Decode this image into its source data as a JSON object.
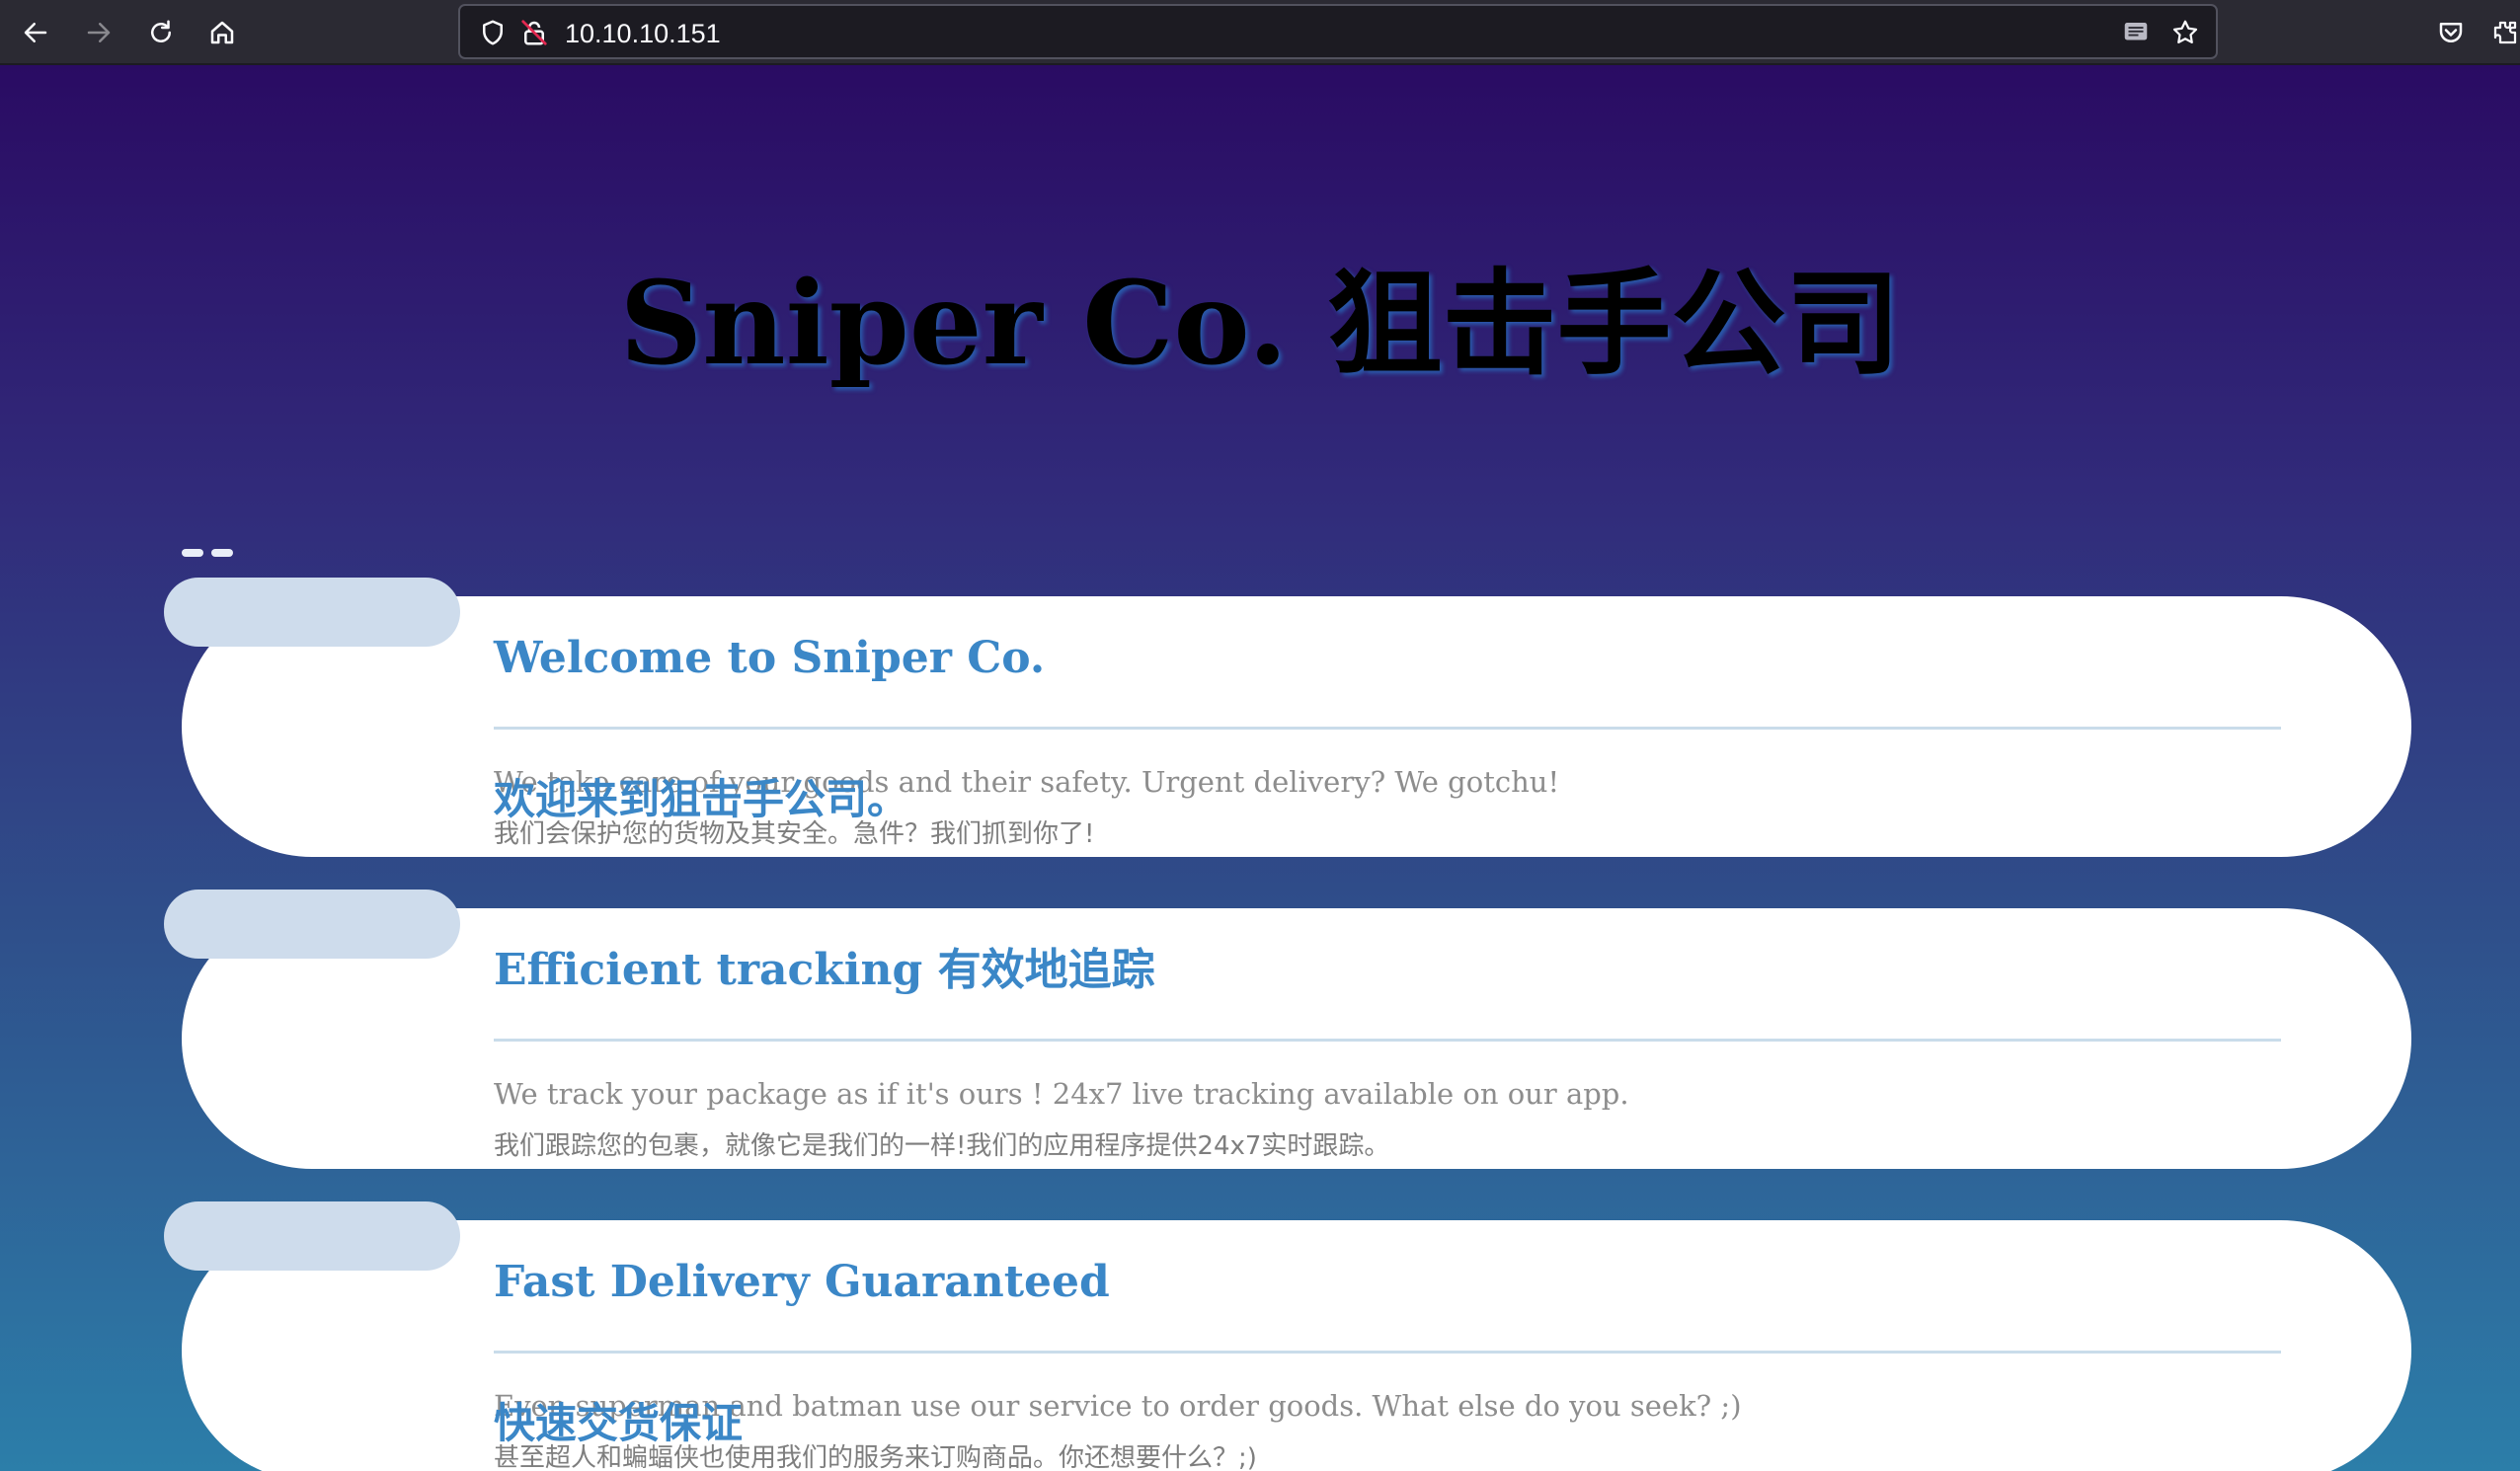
{
  "browser": {
    "url": "10.10.10.151",
    "icons": {
      "back": "back-arrow-icon",
      "forward": "forward-arrow-icon",
      "reload": "reload-icon",
      "home": "home-icon",
      "tracking_protection": "shield-icon",
      "insecure": "insecure-lock-icon",
      "reader": "reader-view-icon",
      "bookmark": "star-icon",
      "pocket": "pocket-icon",
      "extensions": "puzzle-icon"
    },
    "colors": {
      "toolbar": "#2b2a33",
      "urlbar": "#1c1b22",
      "insecure_accent": "#e22850"
    }
  },
  "page": {
    "title": "Sniper Co. 狙击手公司",
    "colors": {
      "gradient_top": "#2a0b63",
      "gradient_bottom": "#2c7ea9",
      "heading": "#3b87c7",
      "body_text": "#8d8d8d",
      "tab": "#cedcec"
    },
    "cards": [
      {
        "title": "Welcome to Sniper Co.",
        "title_zh": "欢迎来到狙击手公司。",
        "text": "We take care of your goods and their safety. Urgent delivery? We gotchu!",
        "text_zh": "我们会保护您的货物及其安全。急件？我们抓到你了!"
      },
      {
        "title": "Efficient tracking 有效地追踪",
        "title_zh": "",
        "text": "We track your package as if it's ours ! 24x7 live tracking available on our app.",
        "text_zh": "我们跟踪您的包裹，就像它是我们的一样!我们的应用程序提供24x7实时跟踪。"
      },
      {
        "title": "Fast Delivery Guaranteed",
        "title_zh": "快速交货保证",
        "text": "Even superman and batman use our service to order goods. What else do you seek? ;)",
        "text_zh": "甚至超人和蝙蝠侠也使用我们的服务来订购商品。你还想要什么？;)"
      }
    ]
  }
}
